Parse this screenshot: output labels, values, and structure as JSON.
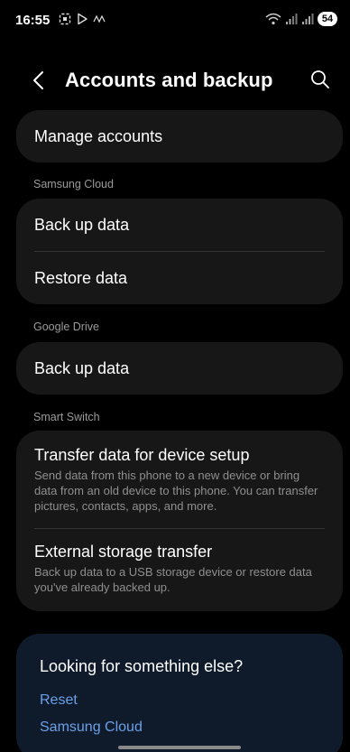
{
  "status_bar": {
    "time": "16:55",
    "left_icons": [
      "screenshot-icon",
      "play-store-icon",
      "signal-wave-icon"
    ],
    "battery": "54"
  },
  "app_bar": {
    "title": "Accounts and backup"
  },
  "manage_accounts": {
    "label": "Manage accounts"
  },
  "samsung_cloud": {
    "section": "Samsung Cloud",
    "items": [
      {
        "label": "Back up data"
      },
      {
        "label": "Restore data"
      }
    ]
  },
  "google_drive": {
    "section": "Google Drive",
    "items": [
      {
        "label": "Back up data"
      }
    ]
  },
  "smart_switch": {
    "section": "Smart Switch",
    "items": [
      {
        "label": "Transfer data for device setup",
        "description": "Send data from this phone to a new device or bring data from an old device to this phone. You can transfer pictures, contacts, apps, and more."
      },
      {
        "label": "External storage transfer",
        "description": "Back up data to a USB storage device or restore data you've already backed up."
      }
    ]
  },
  "suggestions": {
    "title": "Looking for something else?",
    "links": [
      "Reset",
      "Samsung Cloud"
    ]
  },
  "colors": {
    "background": "#000000",
    "card": "#171717",
    "link": "#6aa0e8",
    "suggestion_card": "#0f1b2b"
  }
}
